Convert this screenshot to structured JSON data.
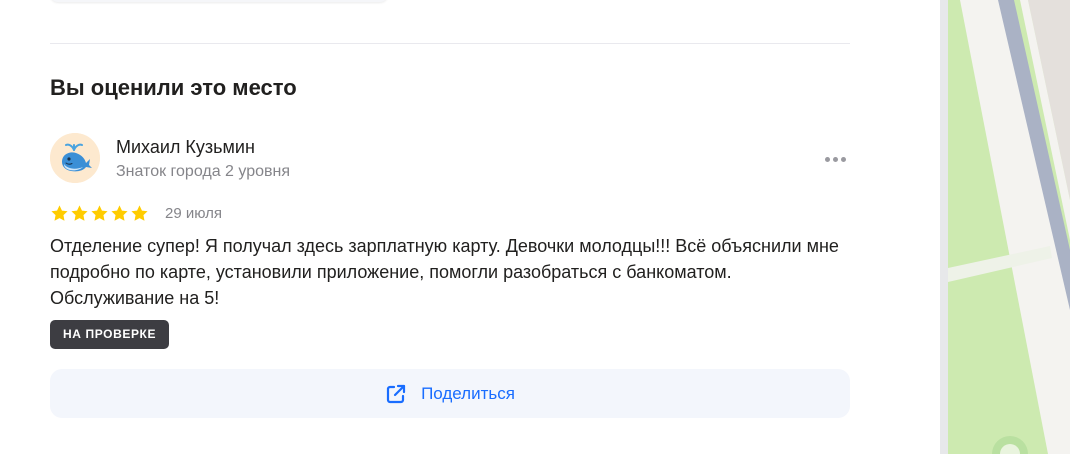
{
  "section": {
    "title": "Вы оценили это место"
  },
  "review": {
    "author_name": "Михаил Кузьмин",
    "author_level": "Знаток города 2 уровня",
    "rating": 5,
    "rating_max": 5,
    "date": "29 июля",
    "text": "Отделение супер! Я получал здесь зарплатную карту. Девочки молодцы!!! Всё объяснили мне подробно по карте, установили приложение, помогли разобраться с банкоматом. Обслуживание на 5!",
    "status_badge": "НА ПРОВЕРКЕ"
  },
  "actions": {
    "share_label": "Поделиться",
    "share_icon": "share-external-icon",
    "more_icon": "more-dots-icon"
  },
  "colors": {
    "accent": "#196dff",
    "star": "#fc0",
    "badge_bg": "#3d3d42",
    "share_bg": "#f3f6fc",
    "map_park": "#cdeab0",
    "map_road": "#aab2c5"
  }
}
